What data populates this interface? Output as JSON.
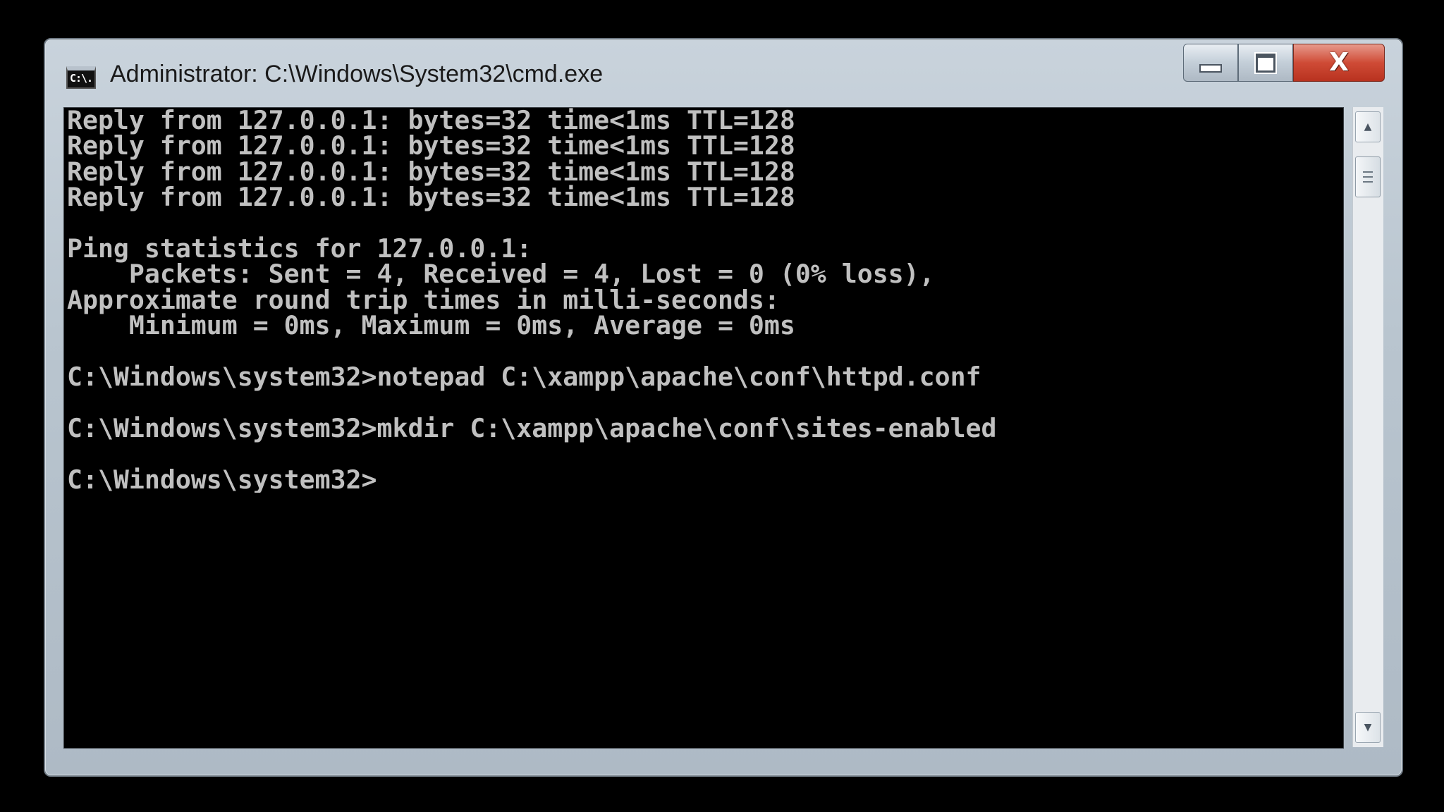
{
  "window": {
    "title": "Administrator: C:\\Windows\\System32\\cmd.exe",
    "icon_label": "C:\\.",
    "icon": "cmd-icon",
    "controls": {
      "minimize_icon": "minimize-icon",
      "maximize_icon": "maximize-icon",
      "close_label": "X"
    }
  },
  "console": {
    "lines": [
      "Reply from 127.0.0.1: bytes=32 time<1ms TTL=128",
      "Reply from 127.0.0.1: bytes=32 time<1ms TTL=128",
      "Reply from 127.0.0.1: bytes=32 time<1ms TTL=128",
      "Reply from 127.0.0.1: bytes=32 time<1ms TTL=128",
      "",
      "Ping statistics for 127.0.0.1:",
      "    Packets: Sent = 4, Received = 4, Lost = 0 (0% loss),",
      "Approximate round trip times in milli-seconds:",
      "    Minimum = 0ms, Maximum = 0ms, Average = 0ms",
      "",
      "C:\\Windows\\system32>notepad C:\\xampp\\apache\\conf\\httpd.conf",
      "",
      "C:\\Windows\\system32>mkdir C:\\xampp\\apache\\conf\\sites-enabled",
      "",
      "C:\\Windows\\system32>"
    ]
  },
  "scrollbar": {
    "up_glyph": "▲",
    "down_glyph": "▼",
    "position": 0.0
  },
  "colors": {
    "console_background": "#000000",
    "console_text": "#c0c0c0",
    "close_button": "#cf4b36"
  }
}
